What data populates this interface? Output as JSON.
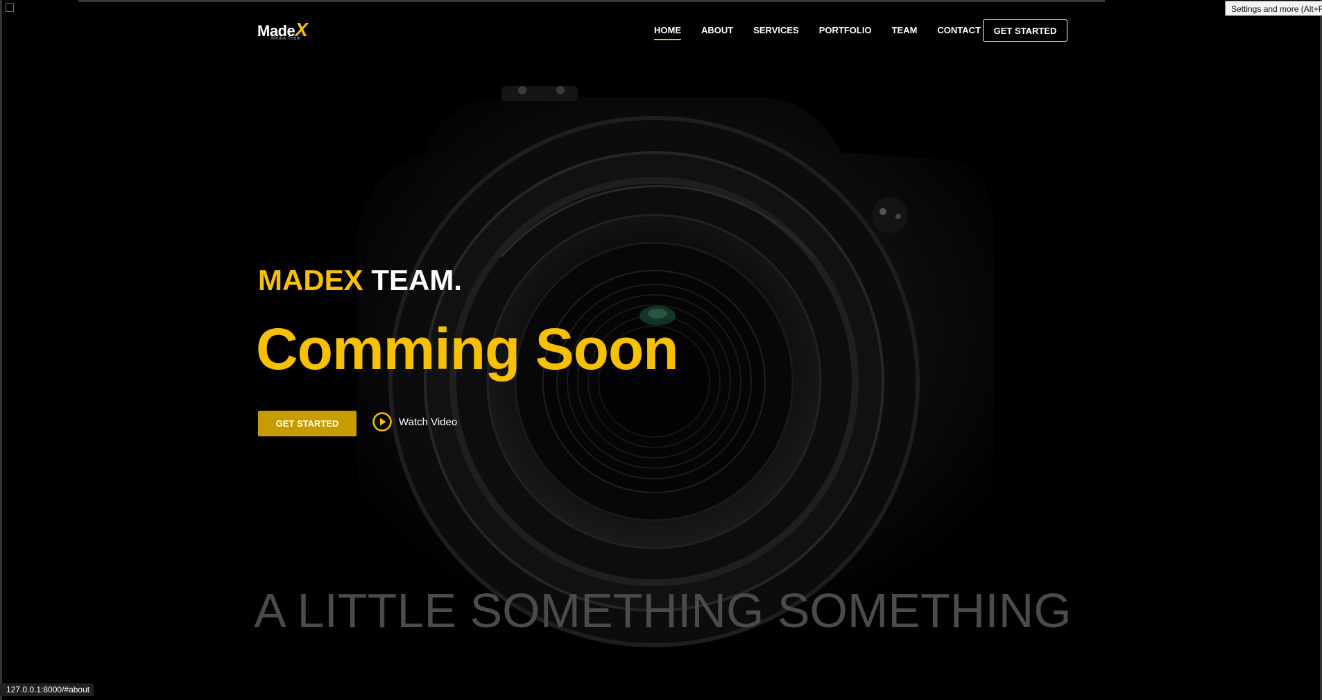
{
  "brand": {
    "name_main": "Made",
    "name_x": "X",
    "sub": "Media Team"
  },
  "nav": {
    "items": [
      {
        "label": "HOME",
        "active": true
      },
      {
        "label": "ABOUT",
        "active": false
      },
      {
        "label": "SERVICES",
        "active": false
      },
      {
        "label": "PORTFOLIO",
        "active": false
      },
      {
        "label": "TEAM",
        "active": false
      },
      {
        "label": "CONTACT",
        "active": false
      }
    ],
    "cta": "GET STARTED"
  },
  "hero": {
    "kicker_highlight": "MADEX",
    "kicker_rest": " TEAM.",
    "title": "Comming Soon",
    "primary_button": "GET STARTED",
    "video_button": "Watch Video",
    "tagline": "A LITTLE SOMETHING SOMETHING"
  },
  "browser": {
    "tooltip": "Settings and more (Alt+F)",
    "status_url": "127.0.0.1:8000/#about"
  },
  "colors": {
    "accent": "#f7c102",
    "button": "#c69c00",
    "background": "#000000"
  }
}
